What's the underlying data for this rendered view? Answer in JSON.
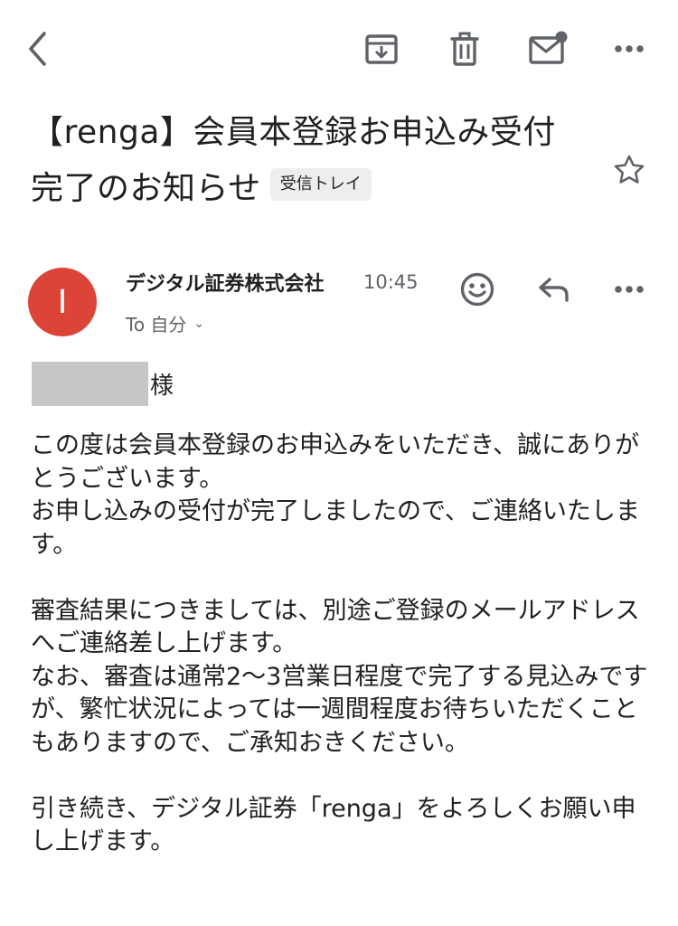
{
  "toolbar": {
    "back_icon": "back-arrow-icon",
    "archive_icon": "archive-icon",
    "delete_icon": "trash-icon",
    "mark_unread_icon": "mail-unread-icon",
    "more_icon": "more-horizontal-icon"
  },
  "email": {
    "subject": "【renga】会員本登録お申込み受付完了のお知らせ",
    "label": "受信トレイ",
    "star_icon": "star-outline-icon"
  },
  "sender": {
    "avatar_letter": "I",
    "avatar_color": "#db4437",
    "name": "デジタル証券株式会社",
    "time": "10:45",
    "to": "To 自分",
    "to_chevron": "⌄"
  },
  "actions": {
    "emoji_icon": "smiley-icon",
    "reply_icon": "reply-icon",
    "more_icon": "more-horizontal-icon"
  },
  "body": {
    "salutation_suffix": "様",
    "text": "この度は会員本登録のお申込みをいただき、誠にありがとうございます。\nお申し込みの受付が完了しましたので、ご連絡いたします。\n\n審査結果につきましては、別途ご登録のメールアドレスへご連絡差し上げます。\nなお、審査は通常2〜3営業日程度で完了する見込みですが、繁忙状況によっては一週間程度お待ちいただくこともありますので、ご承知おきください。\n\n引き続き、デジタル証券「renga」をよろしくお願い申し上げます。"
  }
}
